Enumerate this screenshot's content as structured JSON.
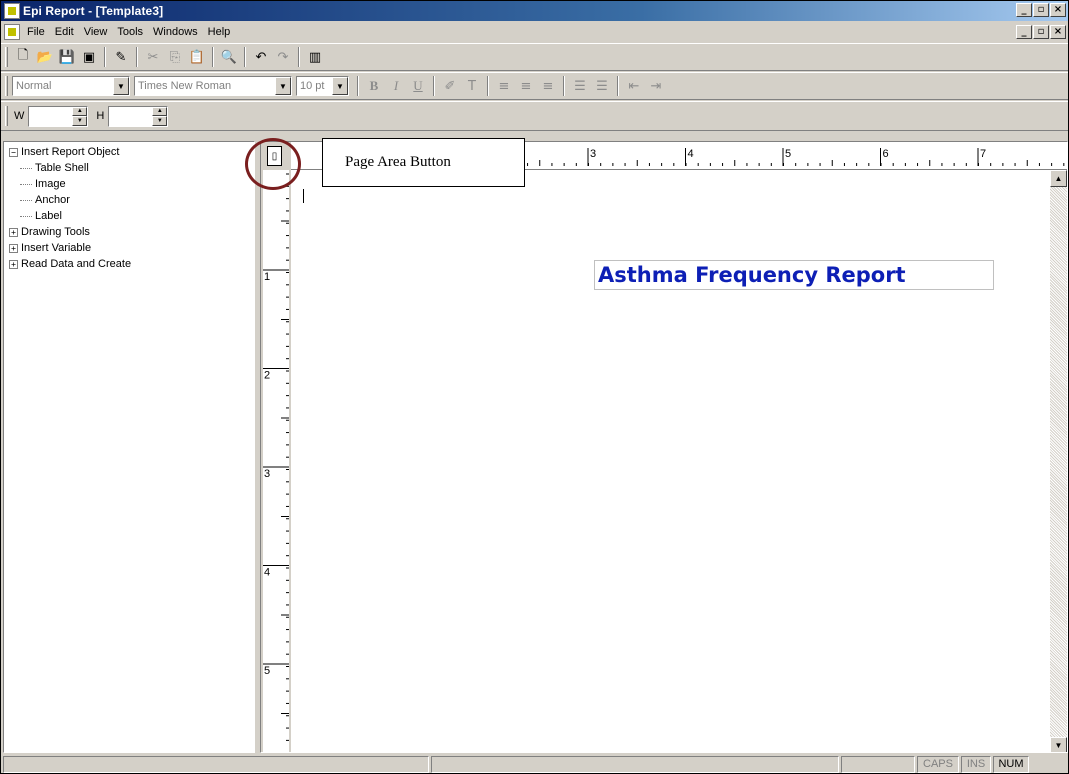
{
  "window": {
    "title": "Epi Report - [Template3]",
    "min_glyph": "_",
    "max_glyph": "▫",
    "close_glyph": "×"
  },
  "menu": {
    "items": [
      "File",
      "Edit",
      "View",
      "Tools",
      "Windows",
      "Help"
    ]
  },
  "format_toolbar": {
    "style_value": "Normal",
    "font_value": "Times New Roman",
    "size_value": "10 pt"
  },
  "dimension_toolbar": {
    "width_label": "W",
    "height_label": "H"
  },
  "tree": {
    "root_label": "Insert Report Object",
    "children": [
      "Table Shell",
      "Image",
      "Anchor",
      "Label"
    ],
    "groups": [
      "Drawing Tools",
      "Insert Variable",
      "Read Data and Create"
    ]
  },
  "ruler": {
    "h_numbers": [
      "3",
      "4",
      "5",
      "6",
      "7"
    ],
    "v_numbers": [
      "1",
      "2",
      "3",
      "4",
      "5"
    ]
  },
  "document": {
    "report_title": "Asthma Frequency Report"
  },
  "callout": {
    "text": "Page Area Button"
  },
  "status": {
    "caps": "CAPS",
    "ins": "INS",
    "num": "NUM"
  }
}
